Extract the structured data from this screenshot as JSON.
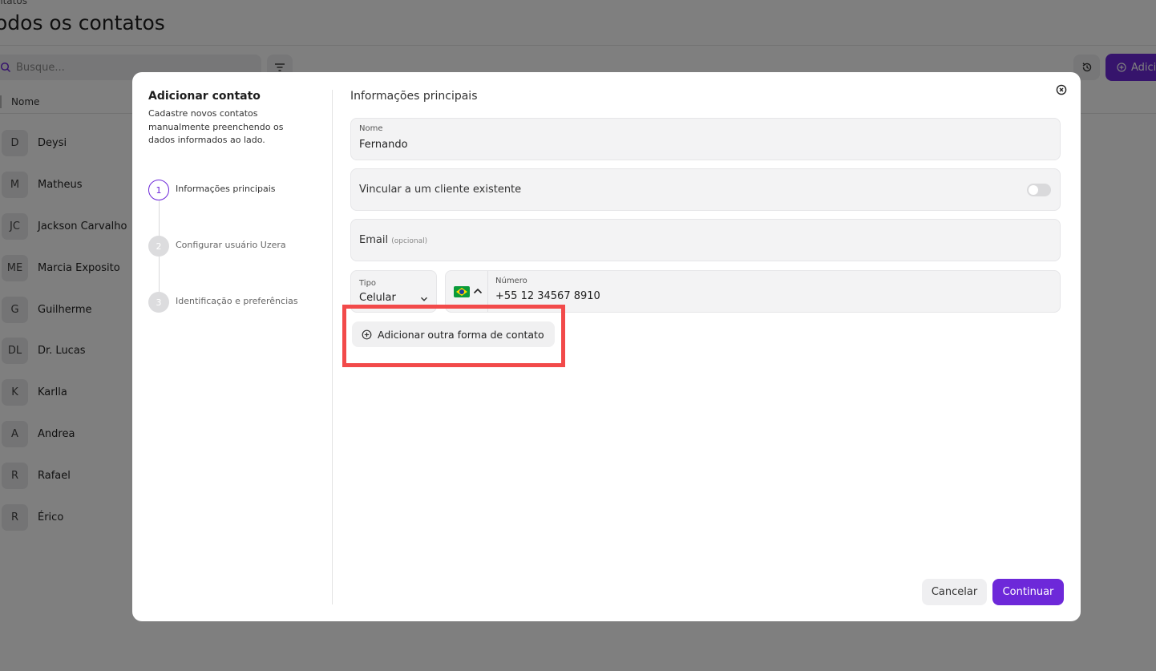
{
  "background": {
    "breadcrumb": "ntatos",
    "title": "odos os contatos",
    "search_placeholder": "Busque...",
    "add_button_label": "Adici",
    "column_header": "Nome",
    "contacts": [
      {
        "initials": "D",
        "name": "Deysi"
      },
      {
        "initials": "M",
        "name": "Matheus"
      },
      {
        "initials": "JC",
        "name": "Jackson Carvalho"
      },
      {
        "initials": "ME",
        "name": "Marcia Exposito"
      },
      {
        "initials": "G",
        "name": "Guilherme"
      },
      {
        "initials": "DL",
        "name": "Dr. Lucas"
      },
      {
        "initials": "K",
        "name": "Karlla"
      },
      {
        "initials": "A",
        "name": "Andrea"
      },
      {
        "initials": "R",
        "name": "Rafael"
      },
      {
        "initials": "R",
        "name": "Érico"
      }
    ]
  },
  "modal": {
    "title": "Adicionar contato",
    "description": "Cadastre novos contatos manualmente preenchendo os dados informados ao lado.",
    "steps": [
      {
        "number": "1",
        "label": "Informações principais",
        "active": true
      },
      {
        "number": "2",
        "label": "Configurar usuário Uzera",
        "active": false
      },
      {
        "number": "3",
        "label": "Identificação e preferências",
        "active": false
      }
    ],
    "section_title": "Informações principais",
    "name_field": {
      "label": "Nome",
      "value": "Fernando"
    },
    "link_client": {
      "label": "Vincular a um cliente existente",
      "enabled": false
    },
    "email_field": {
      "label": "Email",
      "optional": "(opcional)"
    },
    "type_field": {
      "label": "Tipo",
      "value": "Celular"
    },
    "phone_field": {
      "label": "Número",
      "value": "+55 12 34567 8910",
      "country_flag": "brazil-flag-icon"
    },
    "add_contact_method_label": "Adicionar outra forma de contato",
    "cancel_label": "Cancelar",
    "continue_label": "Continuar"
  },
  "colors": {
    "accent": "#6d28d9",
    "highlight": "#f24a4a",
    "overlay": "rgba(0,0,0,0.5)"
  }
}
